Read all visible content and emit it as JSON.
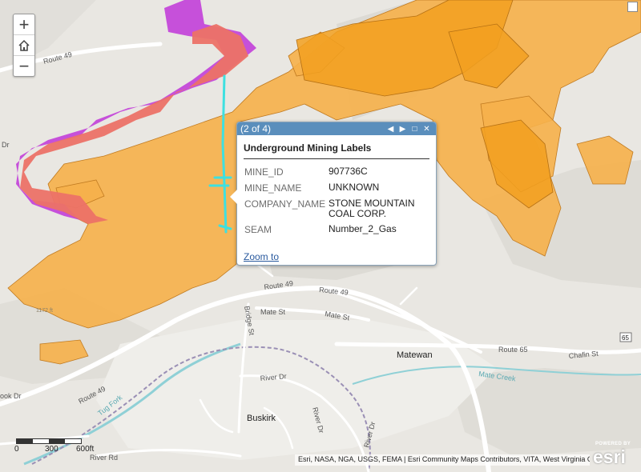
{
  "map": {
    "colors": {
      "background": "#e9e7e2",
      "road": "#ffffff",
      "stream": "#8fd0d6",
      "rail": "#9a8fb5",
      "mine_orange": "#f6b04a",
      "mine_orange_dark": "#f2a020",
      "mine_red": "#ec7267",
      "mine_magenta": "#c23fd9",
      "selected_feature": "#3ee0e0"
    },
    "labels": {
      "route49_nw": "Route 49",
      "route49_center": "Route 49",
      "route49_east": "Route 49",
      "route49_sw": "Route 49",
      "route65": "Route 65",
      "shield65": "65",
      "mate_st_w": "Mate St",
      "mate_st_e": "Mate St",
      "bridge_st": "Bridge St",
      "chafin_st": "Chafin St",
      "mate_creek": "Mate Creek",
      "tug_fork": "Tug Fork",
      "river_dr_1": "River Dr",
      "river_dr_2": "River Dr",
      "river_dr_3": "River Dr",
      "river_rd": "River Rd",
      "hook_dr": "ook Dr",
      "matewan": "Matewan",
      "buskirk": "Buskirk",
      "contour": "1172 ft",
      "edge_dr": "Dr"
    }
  },
  "zoom_controls": {
    "zoom_in": "+",
    "home_icon": "home-icon",
    "zoom_out": "−"
  },
  "popup": {
    "count": "(2 of 4)",
    "prev_icon": "◀",
    "next_icon": "▶",
    "maximize_icon": "□",
    "close_icon": "✕",
    "title": "Underground Mining Labels",
    "fields": [
      {
        "key": "MINE_ID",
        "value": "907736C"
      },
      {
        "key": "MINE_NAME",
        "value": "UNKNOWN"
      },
      {
        "key": "COMPANY_NAME",
        "value": "STONE MOUNTAIN COAL CORP."
      },
      {
        "key": "SEAM",
        "value": "Number_2_Gas"
      }
    ],
    "zoom_to": "Zoom to"
  },
  "scalebar": {
    "label_0": "0",
    "label_300": "300",
    "label_600": "600ft"
  },
  "attribution": "Esri, NASA, NGA, USGS, FEMA | Esri Community Maps Contributors, VITA, West Virginia GIS, ...",
  "logo": {
    "powered": "POWERED BY",
    "brand": "esri"
  }
}
